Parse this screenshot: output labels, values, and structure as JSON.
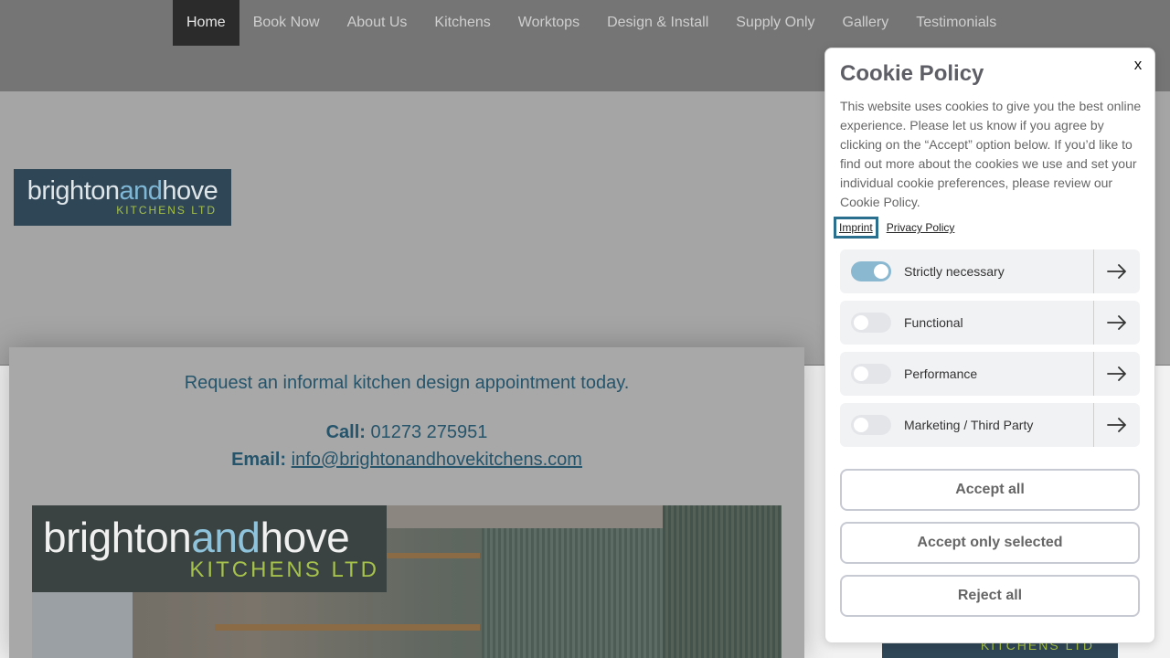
{
  "nav": {
    "items": [
      {
        "label": "Home",
        "active": true
      },
      {
        "label": "Book Now"
      },
      {
        "label": "About Us"
      },
      {
        "label": "Kitchens"
      },
      {
        "label": "Worktops"
      },
      {
        "label": "Design & Install"
      },
      {
        "label": "Supply Only"
      },
      {
        "label": "Gallery"
      },
      {
        "label": "Testimonials"
      }
    ]
  },
  "logo": {
    "brand_main_1": "brighton",
    "brand_main_2": "and",
    "brand_main_3": "hove",
    "brand_sub": "KITCHENS LTD"
  },
  "content": {
    "request_text": "Request an informal kitchen design appointment today.",
    "call_label": "Call:",
    "call_value": " 01273 275951",
    "email_label": "Email:",
    "email_value": "info@brightonandhovekitchens.com"
  },
  "cookie": {
    "close_label": "x",
    "title": "Cookie Policy",
    "text": "This website uses cookies to give you the best online experience. Please let us know if you agree by clicking on the “Accept” option below. If you’d like to find out more about the cookies we use and set your individual cookie preferences, please review our Cookie Policy.",
    "links": {
      "imprint": "Imprint",
      "privacy": "Privacy Policy"
    },
    "options": [
      {
        "label": "Strictly necessary",
        "enabled": true
      },
      {
        "label": "Functional",
        "enabled": false
      },
      {
        "label": "Performance",
        "enabled": false
      },
      {
        "label": "Marketing / Third Party",
        "enabled": false
      }
    ],
    "buttons": {
      "accept_all": "Accept all",
      "accept_selected": "Accept only selected",
      "reject_all": "Reject all"
    }
  },
  "colors": {
    "accent_text": "#25546b",
    "toggle_on": "#8ab8d1",
    "logo_bg": "#2f4657",
    "logo_green": "#a5c04a"
  }
}
